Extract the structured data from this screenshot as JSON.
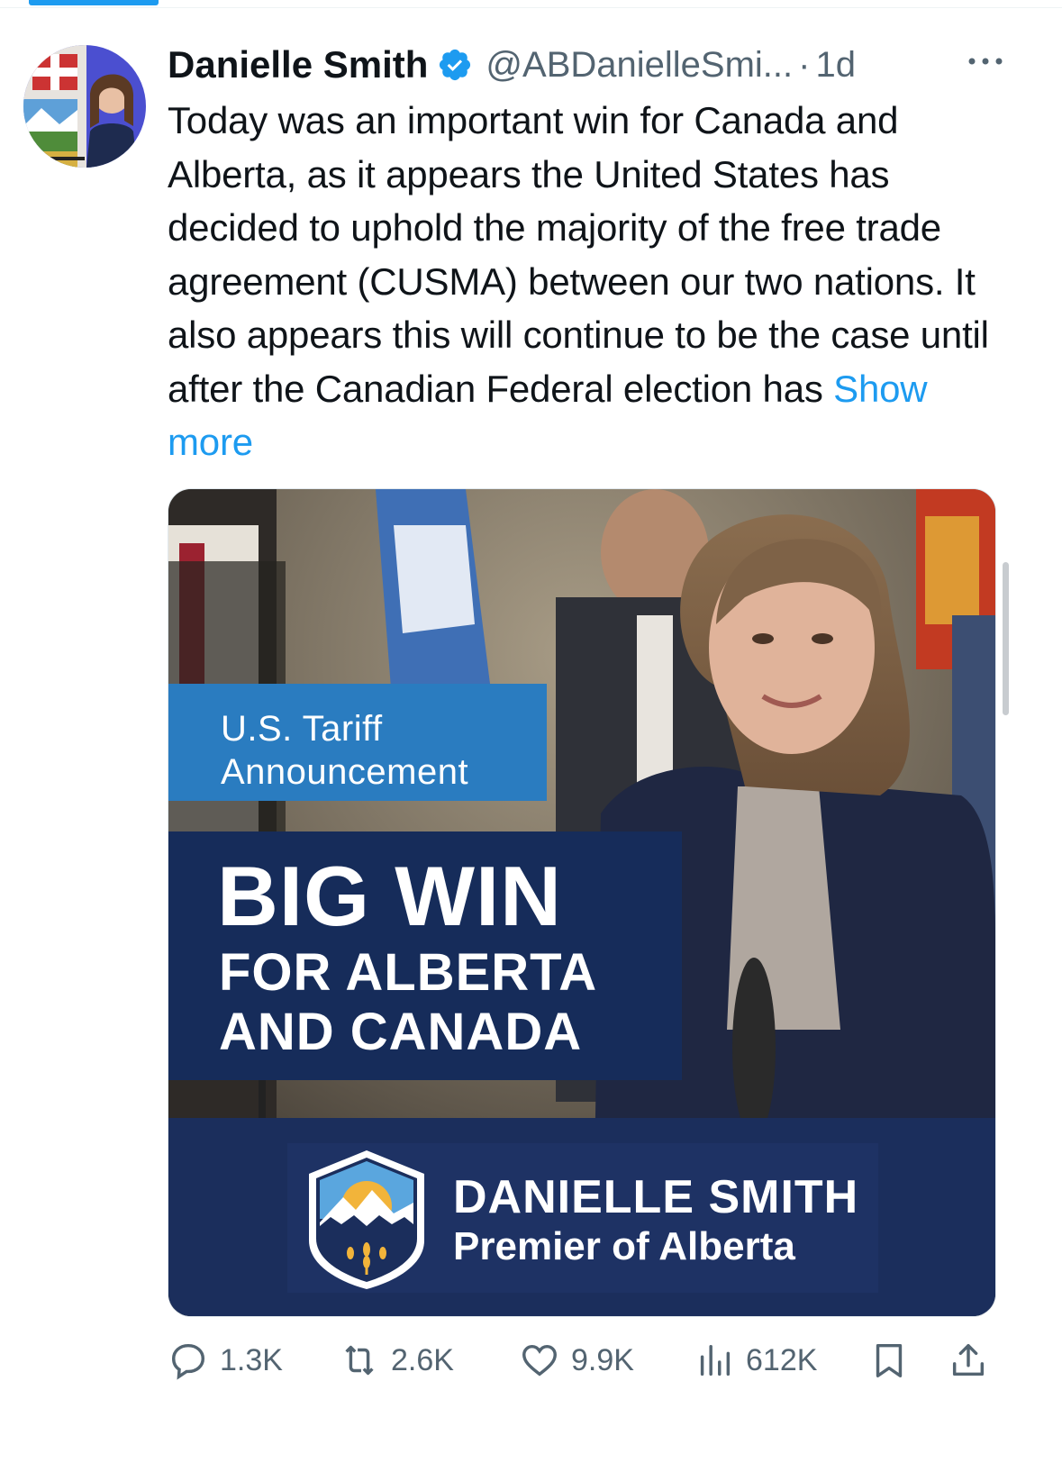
{
  "author": {
    "name": "Danielle Smith",
    "handle": "@ABDanielleSmi...",
    "separator": "·",
    "time": "1d"
  },
  "tweet": {
    "text": "Today was an important win for Canada and Alberta, as it appears the United States has decided to uphold the majority of the free trade agreement (CUSMA) between our two nations. It also appears this will continue to be the case until after the Canadian Federal election has ",
    "show_more": "Show more"
  },
  "media": {
    "tag_line_1": "U.S. Tariff",
    "tag_line_2": "Announcement",
    "headline": "BIG WIN",
    "subhead_1": "FOR ALBERTA",
    "subhead_2": "AND CANADA",
    "brand_name": "DANIELLE SMITH",
    "brand_title": "Premier of Alberta"
  },
  "actions": {
    "replies": "1.3K",
    "reposts": "2.6K",
    "likes": "9.9K",
    "views": "612K"
  },
  "colors": {
    "accent": "#1d9bf0",
    "secondary_text": "#536471",
    "navy": "#162c5a",
    "tag_blue": "#2a7cc0"
  }
}
